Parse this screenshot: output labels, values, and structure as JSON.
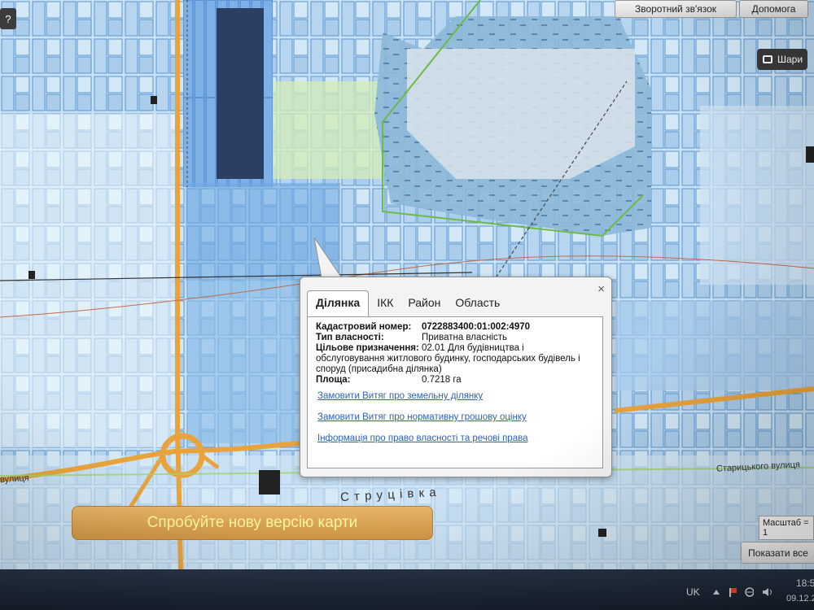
{
  "toolbar": {
    "help_icon": "?",
    "feedback_label": "Зворотний зв'язок",
    "help_label": "Допомога",
    "layers_label": "Шари",
    "layers_icon": "layers-icon"
  },
  "popup": {
    "close_icon": "×",
    "tabs": [
      "Ділянка",
      "ІКК",
      "Район",
      "Область"
    ],
    "active_tab": "Ділянка",
    "fields": {
      "cadastral_label": "Кадастровий номер:",
      "cadastral_value": "0722883400:01:002:4970",
      "ownership_label": "Тип власності:",
      "ownership_value": "Приватна власність",
      "purpose_label": "Цільове призначення:",
      "purpose_value": "02.01 Для будівництва і",
      "purpose_cont": "обслуговування житлового будинку, господарських будівель і споруд (присадибна ділянка)",
      "area_label": "Площа:",
      "area_value": "0.7218 га"
    },
    "links": [
      "Замовити Витяг про земельну ділянку",
      "Замовити Витяг про нормативну грошову оцінку",
      "Інформація про право власності та речові права"
    ]
  },
  "banner": {
    "label": "Спробуйте нову версію карти"
  },
  "map": {
    "street_left": "вулиця",
    "street_right": "Старицького вулиця",
    "street_bottom": "С т р у ц і в к а",
    "scale_label": "Масштаб = 1"
  },
  "footer": {
    "show_all_label": "Показати все"
  },
  "taskbar": {
    "language": "UK",
    "time": "18:5",
    "date": "09.12.2"
  },
  "colors": {
    "parcel_fill": "#b9d6ee",
    "parcel_stroke": "#4d8fd0",
    "road": "#e8a33c",
    "popup_link": "#2f61b4",
    "banner": "#d9a150"
  }
}
